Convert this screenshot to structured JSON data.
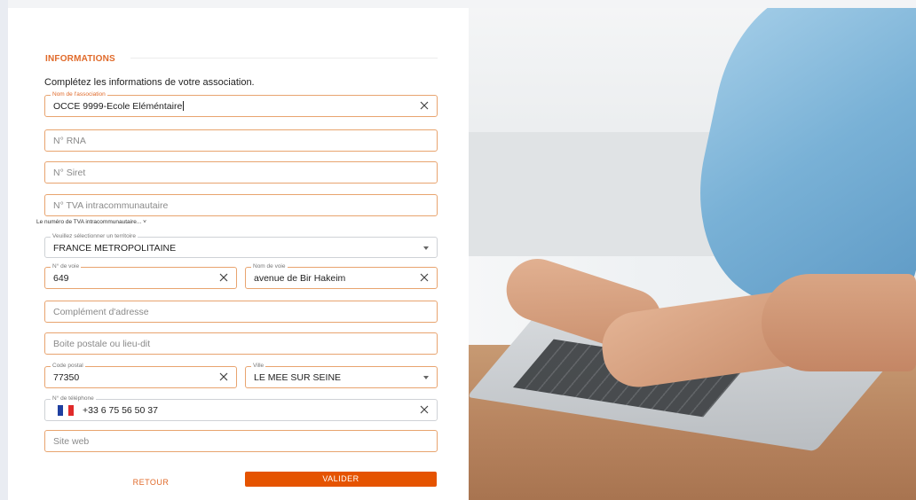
{
  "section": {
    "title": "INFORMATIONS",
    "intro": "Complétez les informations de votre association."
  },
  "fields": {
    "association": {
      "label": "Nom de l'association",
      "value": "OCCE 9999-Ecole Eléméntaire"
    },
    "rna": {
      "placeholder": "N° RNA"
    },
    "siret": {
      "placeholder": "N° Siret"
    },
    "tva": {
      "placeholder": "N° TVA intracommunautaire",
      "helper": "Le numéro de TVA intracommunautaire... ˅"
    },
    "territoire": {
      "label": "Veuillez sélectionner un territoire",
      "value": "FRANCE METROPOLITAINE"
    },
    "num_voie": {
      "label": "N° de voie",
      "value": "649"
    },
    "nom_voie": {
      "label": "Nom de voie",
      "value": "avenue de Bir Hakeim"
    },
    "complement": {
      "placeholder": "Complément d'adresse"
    },
    "boite_postale": {
      "placeholder": "Boite postale ou lieu-dit"
    },
    "code_postal": {
      "label": "Code postal",
      "value": "77350"
    },
    "ville": {
      "label": "Ville",
      "value": "LE MEE SUR SEINE"
    },
    "telephone": {
      "label": "N° de téléphone",
      "value": "+33 6 75 56 50 37"
    },
    "site_web": {
      "placeholder": "Site web"
    }
  },
  "buttons": {
    "retour": "RETOUR",
    "valider": "VALIDER"
  },
  "colors": {
    "accent": "#e06a2a",
    "button": "#e55300",
    "field_border": "#e8a46f"
  },
  "icons": {
    "clear": "close-icon",
    "dropdown": "chevron-down-icon",
    "flag": "france-flag-icon"
  }
}
